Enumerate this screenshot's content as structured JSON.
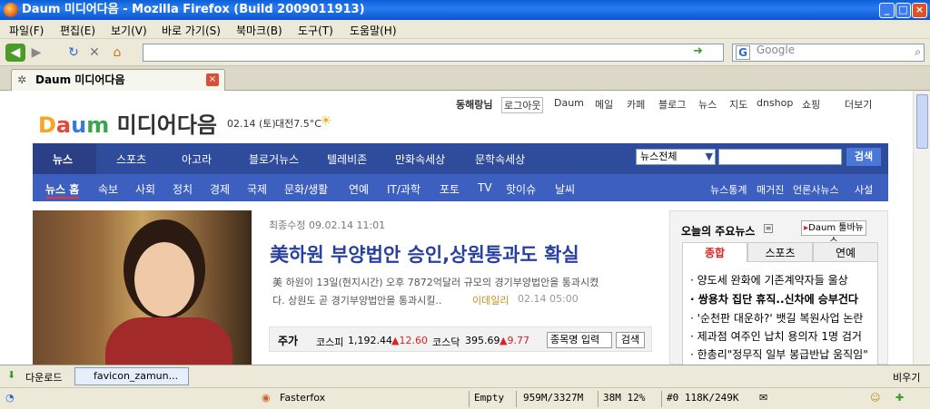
{
  "window": {
    "title": "Daum 미디어다음 - Mozilla Firefox (Build 2009011913)"
  },
  "menubar": [
    "파일(F)",
    "편집(E)",
    "보기(V)",
    "바로 가기(S)",
    "북마크(B)",
    "도구(T)",
    "도움말(H)"
  ],
  "searchbar": {
    "placeholder": "Google"
  },
  "tab": {
    "title": "Daum 미디어다음"
  },
  "page": {
    "topnav": [
      "동해랑님",
      "로그아웃",
      "Daum",
      "메일",
      "카페",
      "블로그",
      "뉴스",
      "지도",
      "dnshop",
      "쇼핑",
      "더보기"
    ],
    "date": "02.14 (토)",
    "weather": "대전7.5°C",
    "logo": "미디어다음",
    "mainmenu": [
      "뉴스",
      "스포츠",
      "아고라",
      "블로거뉴스",
      "텔레비존",
      "만화속세상",
      "문학속세상"
    ],
    "search_select": "뉴스전체",
    "search_button": "검색",
    "submenu": [
      "뉴스 홈",
      "속보",
      "사회",
      "정치",
      "경제",
      "국제",
      "문화/생활",
      "연예",
      "IT/과학",
      "포토",
      "TV",
      "핫이슈",
      "날씨"
    ],
    "submenu_right": [
      "뉴스통계",
      "매거진",
      "언론사뉴스",
      "사설"
    ],
    "updated": "최종수정 09.02.14 11:01",
    "headline": "美하원 부양법안 승인,상원통과도 확실",
    "summary_line1": "美 하원이 13일(현지시간) 오후 7872억달러 규모의 경기부양법안을 통과시켰",
    "summary_line2": "다. 상원도 곧 경기부양법안을 통과시킬..",
    "source": "이데일리",
    "source_time": "02.14 05:00",
    "stock_label": "주가",
    "kospi_label": "코스피",
    "kospi_value": "1,192.44",
    "kospi_change": "▲12.60",
    "kosdaq_label": "코스닥",
    "kosdaq_value": "395.69",
    "kosdaq_change": "▲9.77",
    "stock_input": "종목명 입력",
    "stock_button": "검색",
    "main_news_title": "오늘의 주요뉴스",
    "toolbar_button": "Daum 툴바뉴스",
    "news_tabs": [
      "종합",
      "스포츠",
      "연예"
    ],
    "news_items": [
      "양도세 완화에 기존계약자들 울상",
      "쌍용차 집단 휴직..신차에 승부건다",
      "'순천판 대운하?' 뱃길 복원사업 논란",
      "제과점 여주인 납치 용의자 1명 검거",
      "한총리\"정무직 일부 봉급반납 움직임\""
    ]
  },
  "findbar": {
    "download": "다운로드",
    "item": "favicon_zamun...",
    "right": "비우기"
  },
  "statusbar": {
    "fasterfox": "Fasterfox",
    "empty": "Empty",
    "mem": "959M/3327M",
    "cpu": "38M 12%",
    "net": "#0 118K/249K"
  }
}
